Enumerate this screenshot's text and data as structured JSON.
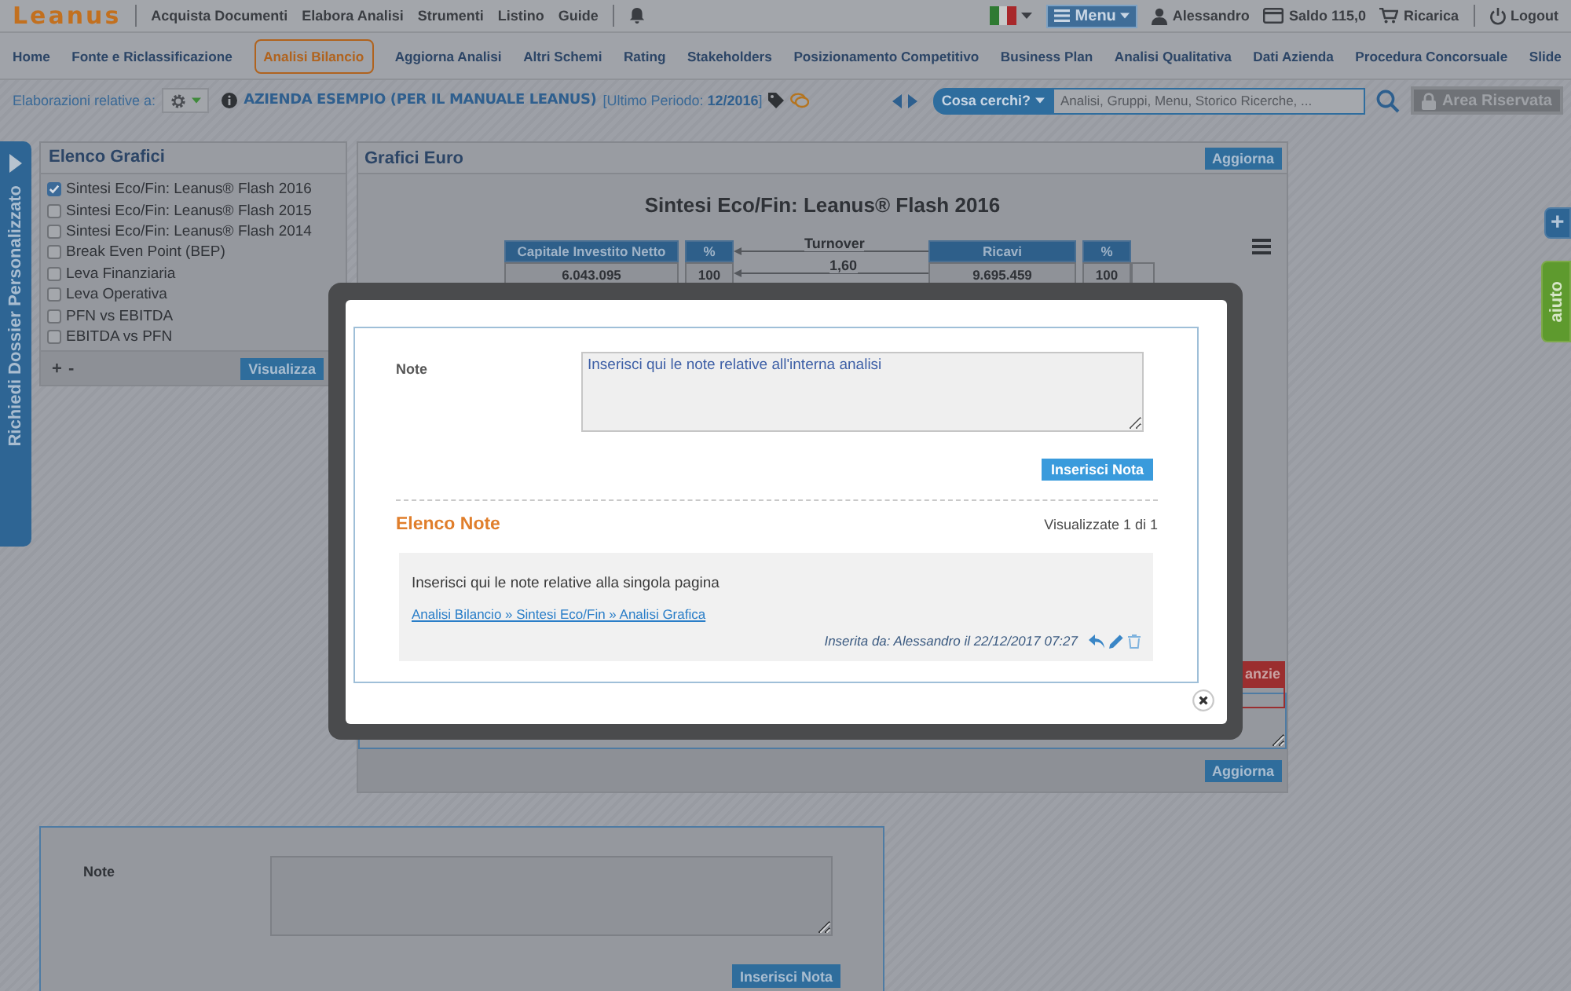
{
  "topbar": {
    "logo": "Leanus",
    "links": [
      "Acquista Documenti",
      "Elabora Analisi",
      "Strumenti",
      "Listino",
      "Guide"
    ],
    "menu": "Menu",
    "user": "Alessandro",
    "balance": "Saldo 115,0",
    "recharge": "Ricarica",
    "logout": "Logout"
  },
  "nav": {
    "tabs": [
      {
        "label": "Home",
        "selected": false
      },
      {
        "label": "Fonte e Riclassificazione",
        "selected": false
      },
      {
        "label": "Analisi Bilancio",
        "selected": true
      },
      {
        "label": "Aggiorna Analisi",
        "selected": false
      },
      {
        "label": "Altri Schemi",
        "selected": false
      },
      {
        "label": "Rating",
        "selected": false
      },
      {
        "label": "Stakeholders",
        "selected": false
      },
      {
        "label": "Posizionamento Competitivo",
        "selected": false
      },
      {
        "label": "Business Plan",
        "selected": false
      },
      {
        "label": "Analisi Qualitativa",
        "selected": false
      },
      {
        "label": "Dati Azienda",
        "selected": false
      },
      {
        "label": "Procedura Concorsuale",
        "selected": false
      },
      {
        "label": "Slide",
        "selected": false
      }
    ]
  },
  "toolbar": {
    "label": "Elaborazioni relative a:",
    "company": "AZIENDA ESEMPIO (PER IL MANUALE LEANUS)",
    "period": "[Ultimo Periodo: **12/2016**]",
    "search_category": "Cosa cerchi?",
    "search_placeholder": "Analisi, Gruppi, Menu, Storico Ricerche, ...",
    "reserved": "Area Riservata"
  },
  "side_tab": {
    "label": "Richiedi Dossier Personalizzato"
  },
  "chart_list": {
    "title": "Elenco Grafici",
    "items": [
      {
        "label": "Sintesi Eco/Fin: Leanus® Flash 2016",
        "checked": true
      },
      {
        "label": "Sintesi Eco/Fin: Leanus® Flash 2015",
        "checked": false
      },
      {
        "label": "Sintesi Eco/Fin: Leanus® Flash 2014",
        "checked": false
      },
      {
        "label": "Break Even Point (BEP)",
        "checked": false
      },
      {
        "label": "Leva Finanziaria",
        "checked": false
      },
      {
        "label": "Leva Operativa",
        "checked": false
      },
      {
        "label": "PFN vs EBITDA",
        "checked": false
      },
      {
        "label": "EBITDA vs PFN",
        "checked": false
      }
    ],
    "add": "+",
    "remove": "-",
    "button": "Visualizza"
  },
  "chart_panel": {
    "title": "Grafici Euro",
    "update_top": "Aggiorna",
    "chart_title": "Sintesi Eco/Fin: Leanus® Flash 2016",
    "boxes": [
      {
        "header": "Capitale Investito Netto",
        "value": "6.043.095"
      },
      {
        "header": "%",
        "value": "100"
      },
      {
        "header": "Ricavi",
        "value": "9.695.459"
      },
      {
        "header": "%",
        "value": "100"
      }
    ],
    "turnover": {
      "label": "Turnover",
      "value": "1,60"
    },
    "alert_button": "anzie",
    "update_bottom": "Aggiorna"
  },
  "right_tabs": {
    "add": "+",
    "help": "aiuto"
  },
  "bottom_form": {
    "label": "Note",
    "submit": "Inserisci Nota"
  },
  "modal": {
    "note_label": "Note",
    "note_value": "Inserisci qui le note relative all'interna analisi",
    "submit": "Inserisci Nota",
    "list_title": "Elenco Note",
    "count": "Visualizzate 1 di 1",
    "notes": [
      {
        "text": "Inserisci qui le note relative alla singola pagina",
        "link": "Analisi Bilancio » Sintesi Eco/Fin » Analisi Grafica",
        "meta": "Inserita da: Alessandro il 22/12/2017 07:27"
      }
    ]
  }
}
